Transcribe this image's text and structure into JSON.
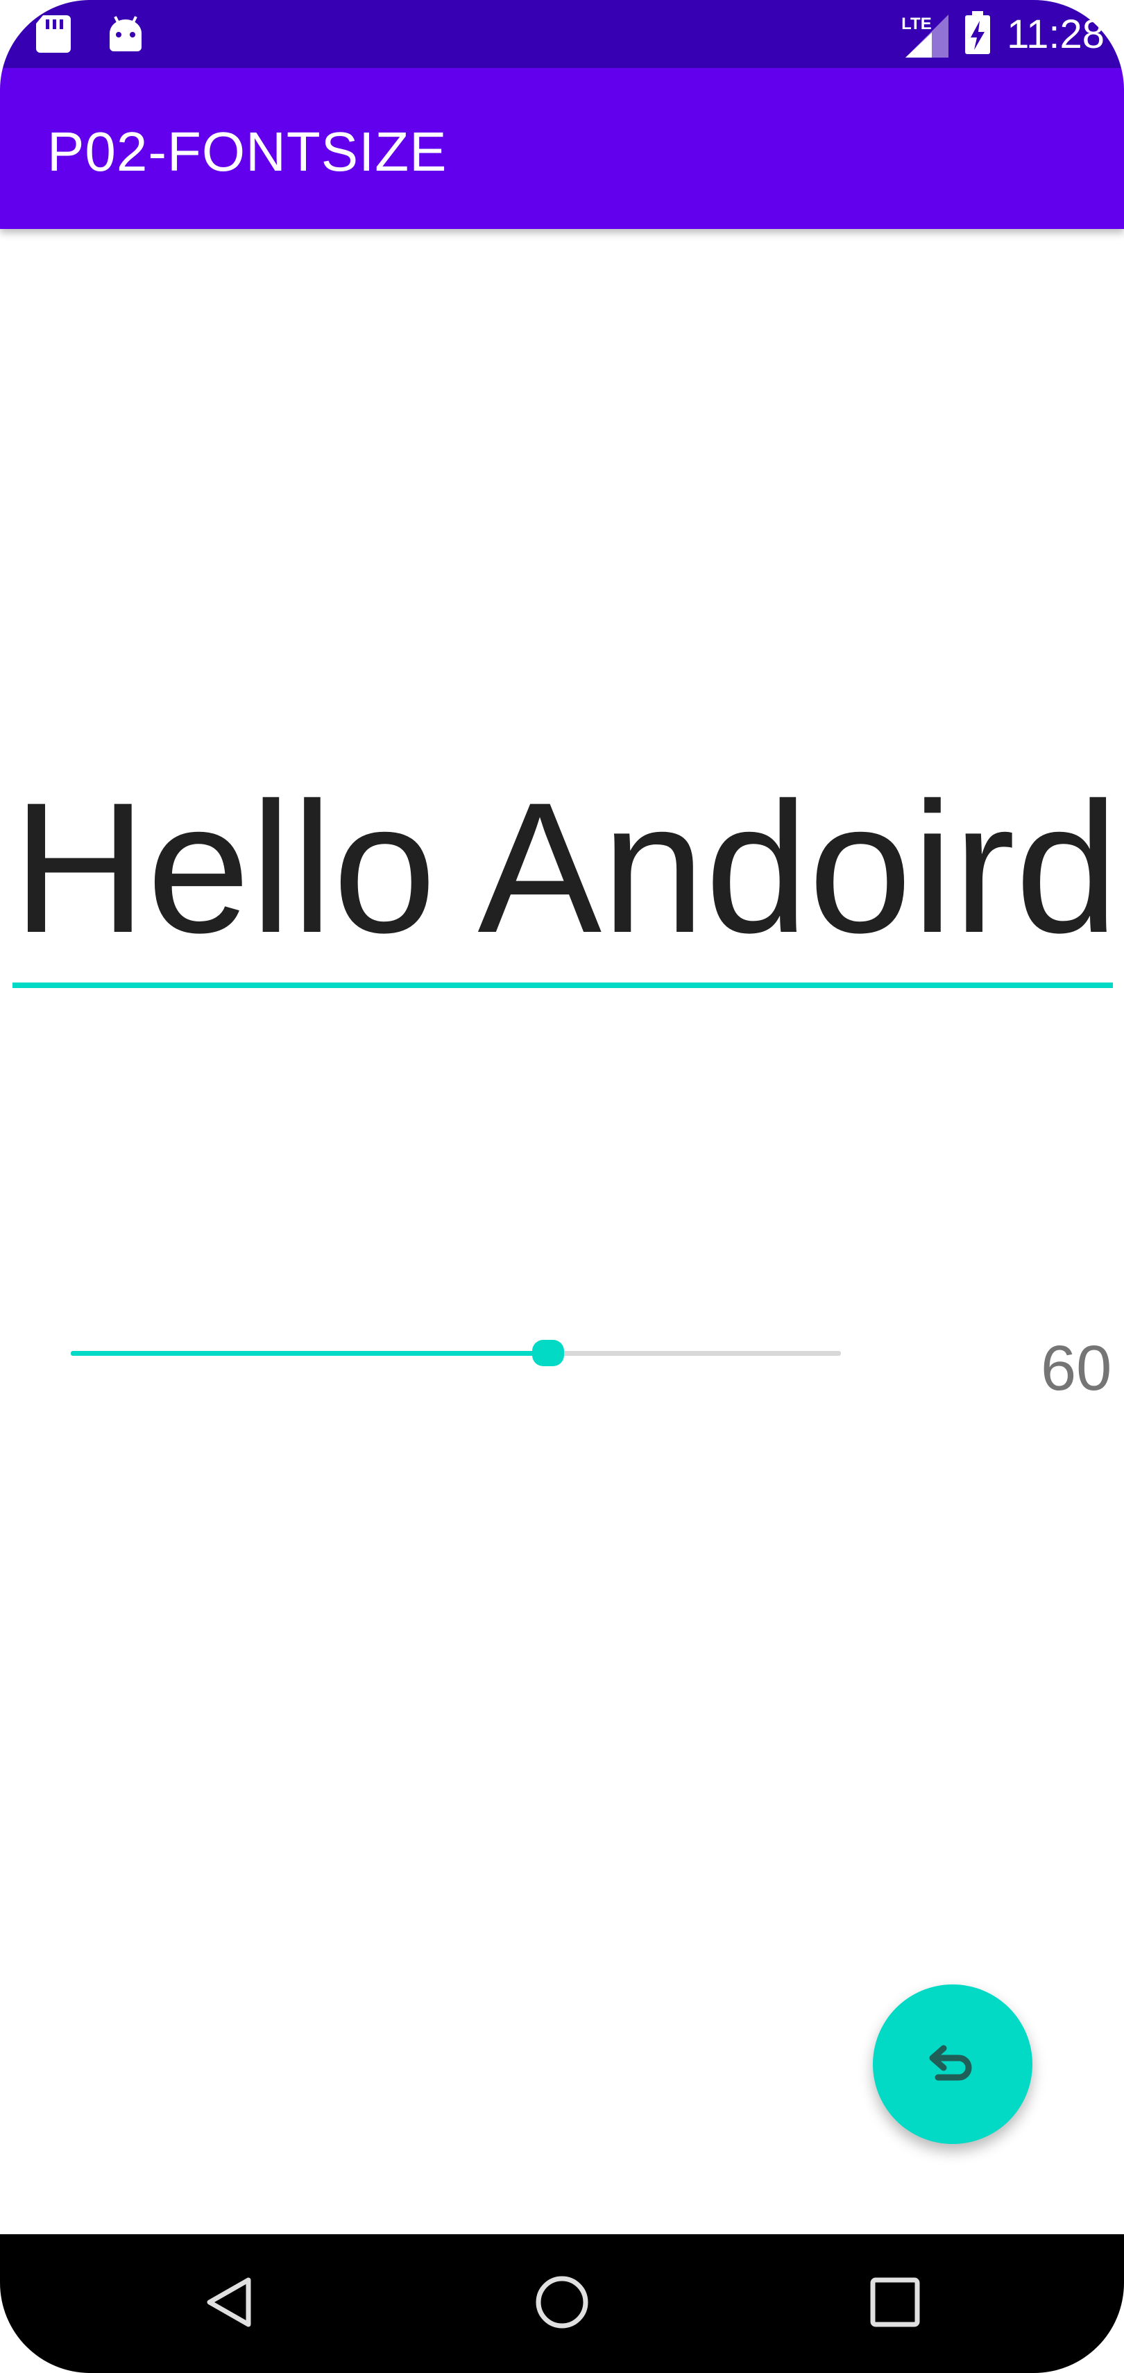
{
  "status_bar": {
    "time": "11:28",
    "network_label": "LTE",
    "icons": [
      "sd-card-icon",
      "android-icon",
      "signal-icon",
      "battery-charging-icon"
    ]
  },
  "app_bar": {
    "title": "P02-FONTSIZE"
  },
  "editor": {
    "text_value": "Hello Andoird!"
  },
  "font_slider": {
    "value_label": "60",
    "progress": 0.62
  },
  "fab": {
    "icon": "undo-icon"
  },
  "nav_bar": {
    "icons": [
      "back-triangle-icon",
      "home-circle-icon",
      "recents-square-icon"
    ]
  },
  "colors": {
    "status_bar": "#3700b3",
    "app_bar": "#6200ee",
    "accent": "#03dac5",
    "text_primary": "#212121",
    "text_secondary": "#757575",
    "nav_bar": "#000000"
  }
}
